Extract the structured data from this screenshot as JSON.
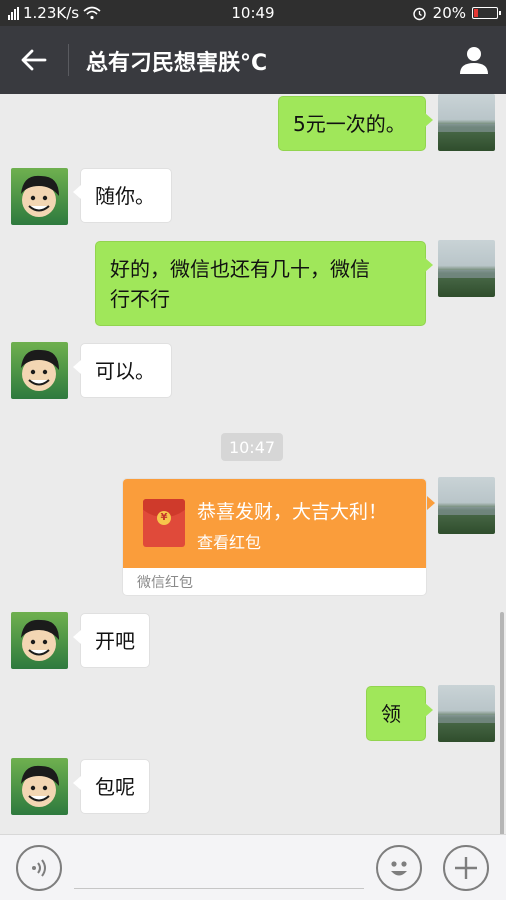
{
  "status_bar": {
    "network_speed": "1.23K/s",
    "time": "10:49",
    "battery": "20%",
    "battery_level": 0.2,
    "icons": [
      "signal-icon",
      "wifi-icon",
      "alarm-icon",
      "battery-icon"
    ]
  },
  "header": {
    "title": "总有刁民想害朕°C",
    "back_icon": "back-arrow-icon",
    "profile_icon": "person-icon"
  },
  "messages": [
    {
      "side": "out",
      "text": "5元一次的。"
    },
    {
      "side": "in",
      "text": "随你。"
    },
    {
      "side": "out",
      "text_line1": "好的，微信也还有几十，微信",
      "text_line2": "行不行"
    },
    {
      "side": "in",
      "text": "可以。"
    },
    {
      "type": "timestamp",
      "text": "10:47"
    },
    {
      "side": "out",
      "type": "red_packet",
      "title": "恭喜发财，大吉大利！",
      "action": "查看红包",
      "footer": "微信红包",
      "coin_symbol": "¥"
    },
    {
      "side": "in",
      "text": "开吧"
    },
    {
      "side": "out",
      "text": "领"
    },
    {
      "side": "in",
      "text": "包呢"
    }
  ],
  "input_bar": {
    "placeholder": "",
    "voice_icon": "voice-icon",
    "emoji_icon": "emoji-icon",
    "plus_icon": "plus-icon"
  },
  "colors": {
    "outgoing_bubble": "#a0e75a",
    "incoming_bubble": "#ffffff",
    "red_packet": "#fa9d3b",
    "titlebar": "#393a3f",
    "background": "#ebebeb"
  }
}
